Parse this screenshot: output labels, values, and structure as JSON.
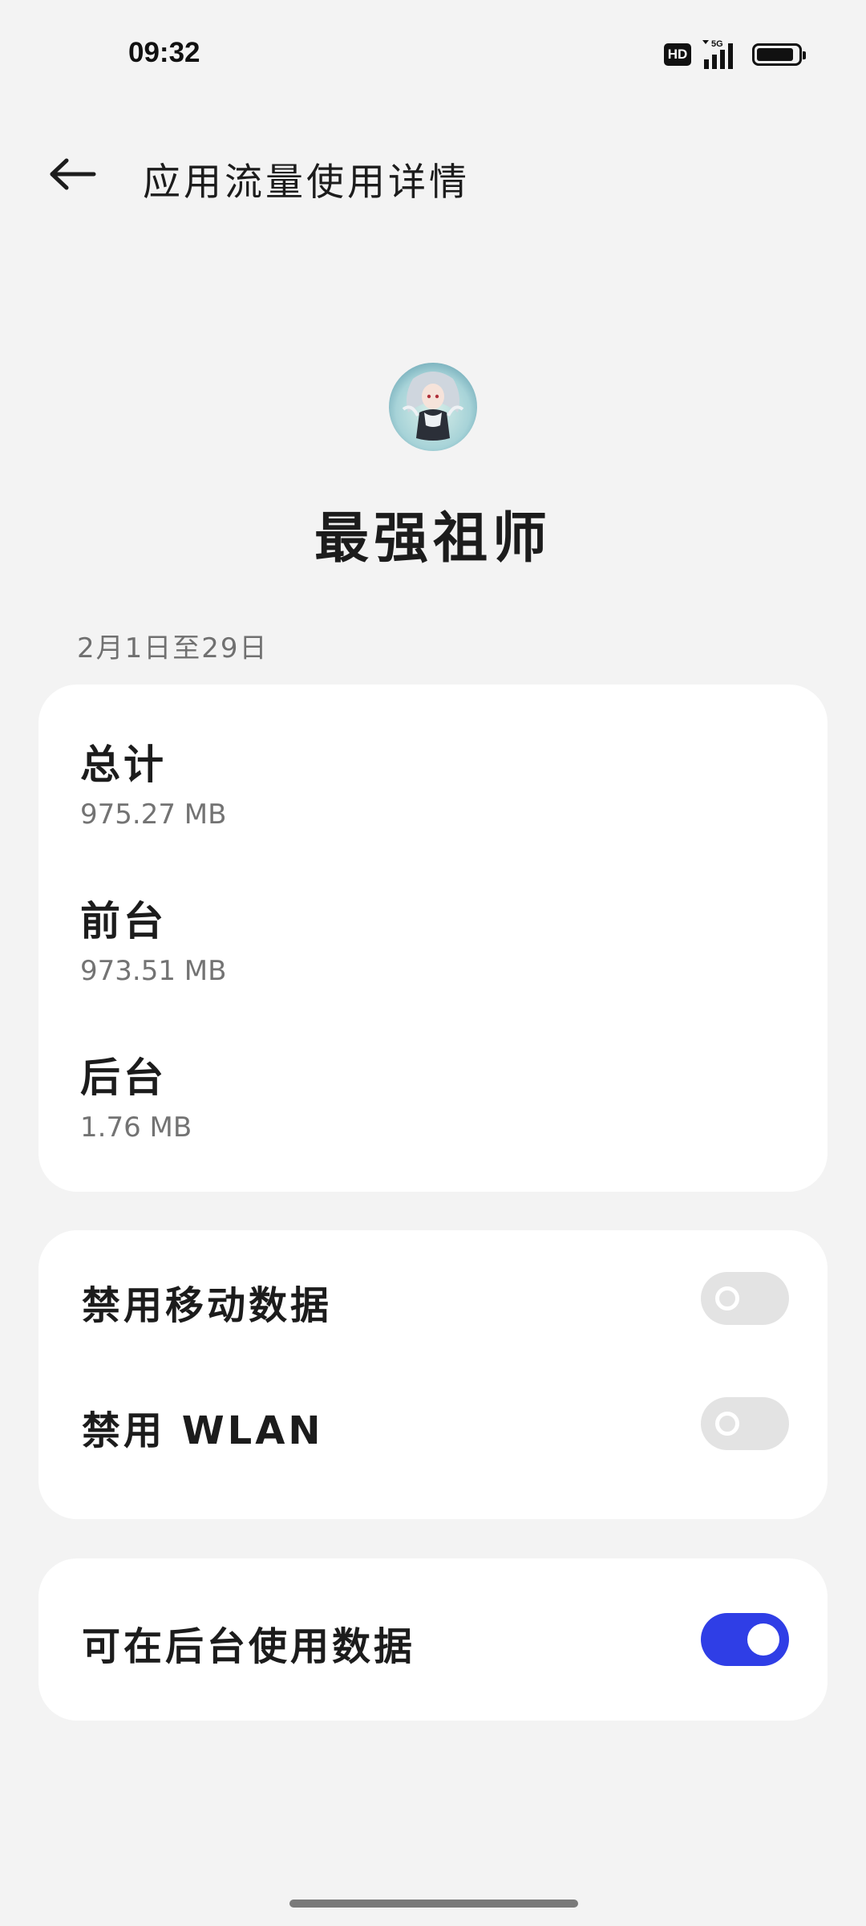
{
  "status_bar": {
    "time": "09:32",
    "hd_label": "HD",
    "network_label": "5G",
    "battery_level": 0.9
  },
  "header": {
    "title": "应用流量使用详情"
  },
  "app": {
    "name": "最强祖师"
  },
  "usage": {
    "date_range": "2月1日至29日",
    "items": [
      {
        "label": "总计",
        "value": "975.27 MB"
      },
      {
        "label": "前台",
        "value": "973.51 MB"
      },
      {
        "label": "后台",
        "value": "1.76 MB"
      }
    ]
  },
  "restrictions": {
    "items": [
      {
        "label": "禁用移动数据",
        "enabled": false
      },
      {
        "label": "禁用 WLAN",
        "enabled": false
      }
    ]
  },
  "background_data": {
    "label": "可在后台使用数据",
    "enabled": true
  },
  "colors": {
    "background": "#f3f3f3",
    "card": "#ffffff",
    "toggle_on": "#2f3ee6",
    "toggle_off": "#e3e3e3",
    "secondary_text": "#737373"
  }
}
